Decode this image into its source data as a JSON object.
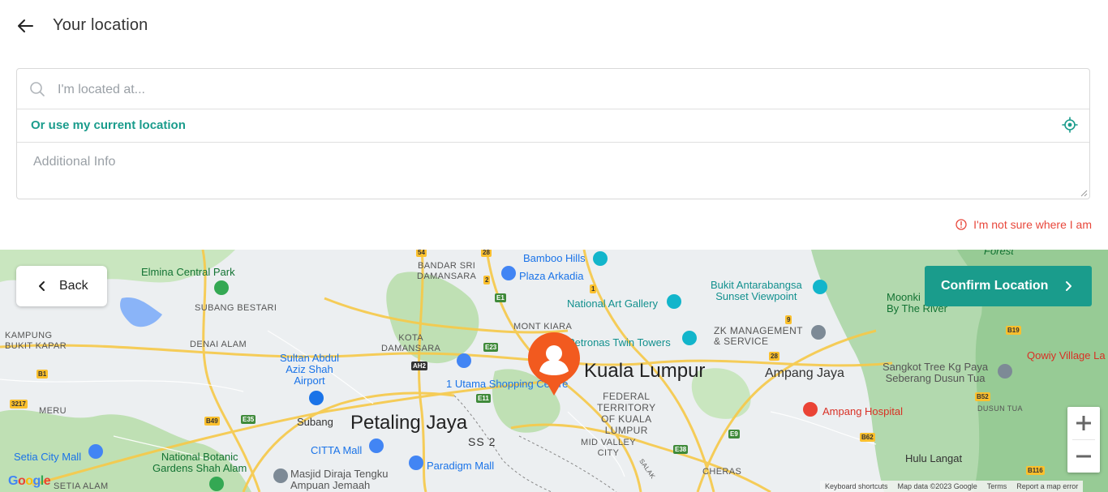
{
  "header": {
    "title": "Your location",
    "back_icon": "arrow-left-icon"
  },
  "form": {
    "search_placeholder": "I'm located at...",
    "search_value": "",
    "current_location_label": "Or use my current location",
    "additional_info_placeholder": "Additional Info",
    "additional_info_value": ""
  },
  "unsure_label": "I'm not sure where I am",
  "map": {
    "back_label": "Back",
    "confirm_label": "Confirm Location",
    "labels": {
      "elmina": "Elmina Central Park",
      "subang_bestari": "SUBANG BESTARI",
      "kampung_bukit_kapar": "KAMPUNG\nBUKIT KAPAR",
      "denai_alam": "DENAI ALAM",
      "meru": "MERU",
      "setia_city": "Setia City Mall",
      "setia_alam": "SETIA ALAM",
      "botanic": "National Botanic\nGardens Shah Alam",
      "bandar_sri": "BANDAR SRI\nDAMANSARA",
      "kota_damansara": "KOTA\nDAMANSARA",
      "airport": "Sultan Abdul\nAziz Shah\nAirport",
      "subang": "Subang",
      "citta": "CITTA Mall",
      "masjid": "Masjid Diraja Tengku\nAmpuan Jemaah",
      "petaling_jaya": "Petaling Jaya",
      "ss2": "SS 2",
      "utama": "1 Utama Shopping Centre",
      "paradigm": "Paradigm Mall",
      "bamboo": "Bamboo Hills",
      "plaza_arkadia": "Plaza Arkadia",
      "mont_kiara": "MONT KIARA",
      "national_art": "National Art Gallery",
      "petronas": "Petronas Twin Towers",
      "kuala_lumpur": "Kuala Lumpur",
      "federal": "FEDERAL\nTERRITORY\nOF KUALA\nLUMPUR",
      "mid_valley": "MID VALLEY\nCITY",
      "cheras": "CHERAS",
      "salak": "SALAK",
      "bukit_antarabangsa": "Bukit Antarabangsa\nSunset Viewpoint",
      "zk": "ZK MANAGEMENT\n& SERVICE",
      "ampang_jaya": "Ampang Jaya",
      "ampang_hospital": "Ampang Hospital",
      "moonki": "Moonki\nBy The River",
      "forest": "Forest",
      "sangkot": "Sangkot Tree Kg Paya\nSeberang Dusun Tua",
      "qowiy": "Qowiy Village La",
      "dusun_tua": "DUSUN TUA",
      "hulu_langat": "Hulu Langat"
    },
    "road_badges": {
      "r54": "54",
      "r28a": "28",
      "r2": "2",
      "r1": "1",
      "e1": "E1",
      "e23": "E23",
      "ah2": "AH2",
      "e11": "E11",
      "b1": "B1",
      "r3217": "3217",
      "b49": "B49",
      "e35": "E35",
      "r28b": "28",
      "r9": "9",
      "b19": "B19",
      "b52": "B52",
      "b62": "B62",
      "e9": "E9",
      "e38": "E38",
      "b116": "B116"
    },
    "zoom_in_icon": "plus-icon",
    "zoom_out_icon": "minus-icon",
    "pin_icon": "user-pin-icon",
    "attribution": {
      "logo": "Google",
      "shortcuts": "Keyboard shortcuts",
      "data": "Map data ©2023 Google",
      "terms": "Terms",
      "report": "Report a map error"
    }
  },
  "colors": {
    "accent": "#1a9c8c",
    "warning": "#e8473b",
    "pin": "#f25a1f"
  }
}
